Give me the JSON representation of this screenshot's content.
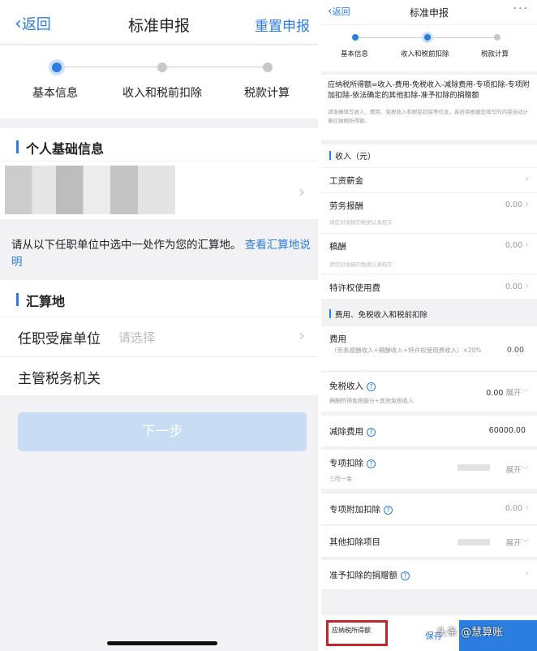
{
  "left": {
    "nav": {
      "back": "返回",
      "title": "标准申报",
      "reset": "重置申报"
    },
    "steps": [
      "基本信息",
      "收入和税前扣除",
      "税款计算"
    ],
    "section_personal": "个人基础信息",
    "notice": "请从以下任职单位中选中一处作为您的汇算地。",
    "notice_link": "查看汇算地说明",
    "section_settle": "汇算地",
    "employer_label": "任职受雇单位",
    "employer_placeholder": "请选择",
    "tax_office_label": "主管税务机关",
    "next_button": "下一步"
  },
  "right": {
    "nav": {
      "back": "返回",
      "title": "标准申报",
      "more": "···"
    },
    "steps": [
      "基本信息",
      "收入和税前扣除",
      "税款计算"
    ],
    "formula": "应纳税所得额=收入-费用-免税收入-减除费用-专项扣除-专项附加扣除-依法确定的其他扣除-准予扣除的捐赠额",
    "formula_note": "请准确填写收入、费用、免税收入和税前扣除等信息，系统将根据您填写的内容自动计算应纳税所得额。",
    "income_title": "收入（元）",
    "wage": "工资薪金",
    "labor": "劳务报酬",
    "labor_value": "0.00",
    "labor_hint": "请您对填报的数据认真核实",
    "royalty": "稿酬",
    "royalty_value": "0.00",
    "royalty_hint": "请您对填报的数据认真核实",
    "franchise": "特许权使用费",
    "franchise_value": "0.00",
    "deduct_title": "费用、免税收入和税前扣除",
    "expense": "费用",
    "expense_note": "（劳务报酬收入+稿酬收入+特许权使用费收入）×20%",
    "expense_value": "0.00",
    "taxfree": "免税收入",
    "taxfree_value": "0.00",
    "taxfree_expand": "展开",
    "taxfree_note": "稿酬所得免税部分+其他免税收入",
    "reduction": "减除费用",
    "reduction_value": "60000.00",
    "special": "专项扣除",
    "special_note": "三险一金",
    "special_expand": "展开",
    "special_add": "专项附加扣除",
    "special_add_value": "0.00",
    "other": "其他扣除项目",
    "other_expand": "展开",
    "donation": "准予扣除的捐赠额",
    "bottom_label": "应纳税所得额",
    "save": "保存",
    "watermark": "头条 @慧算账"
  }
}
